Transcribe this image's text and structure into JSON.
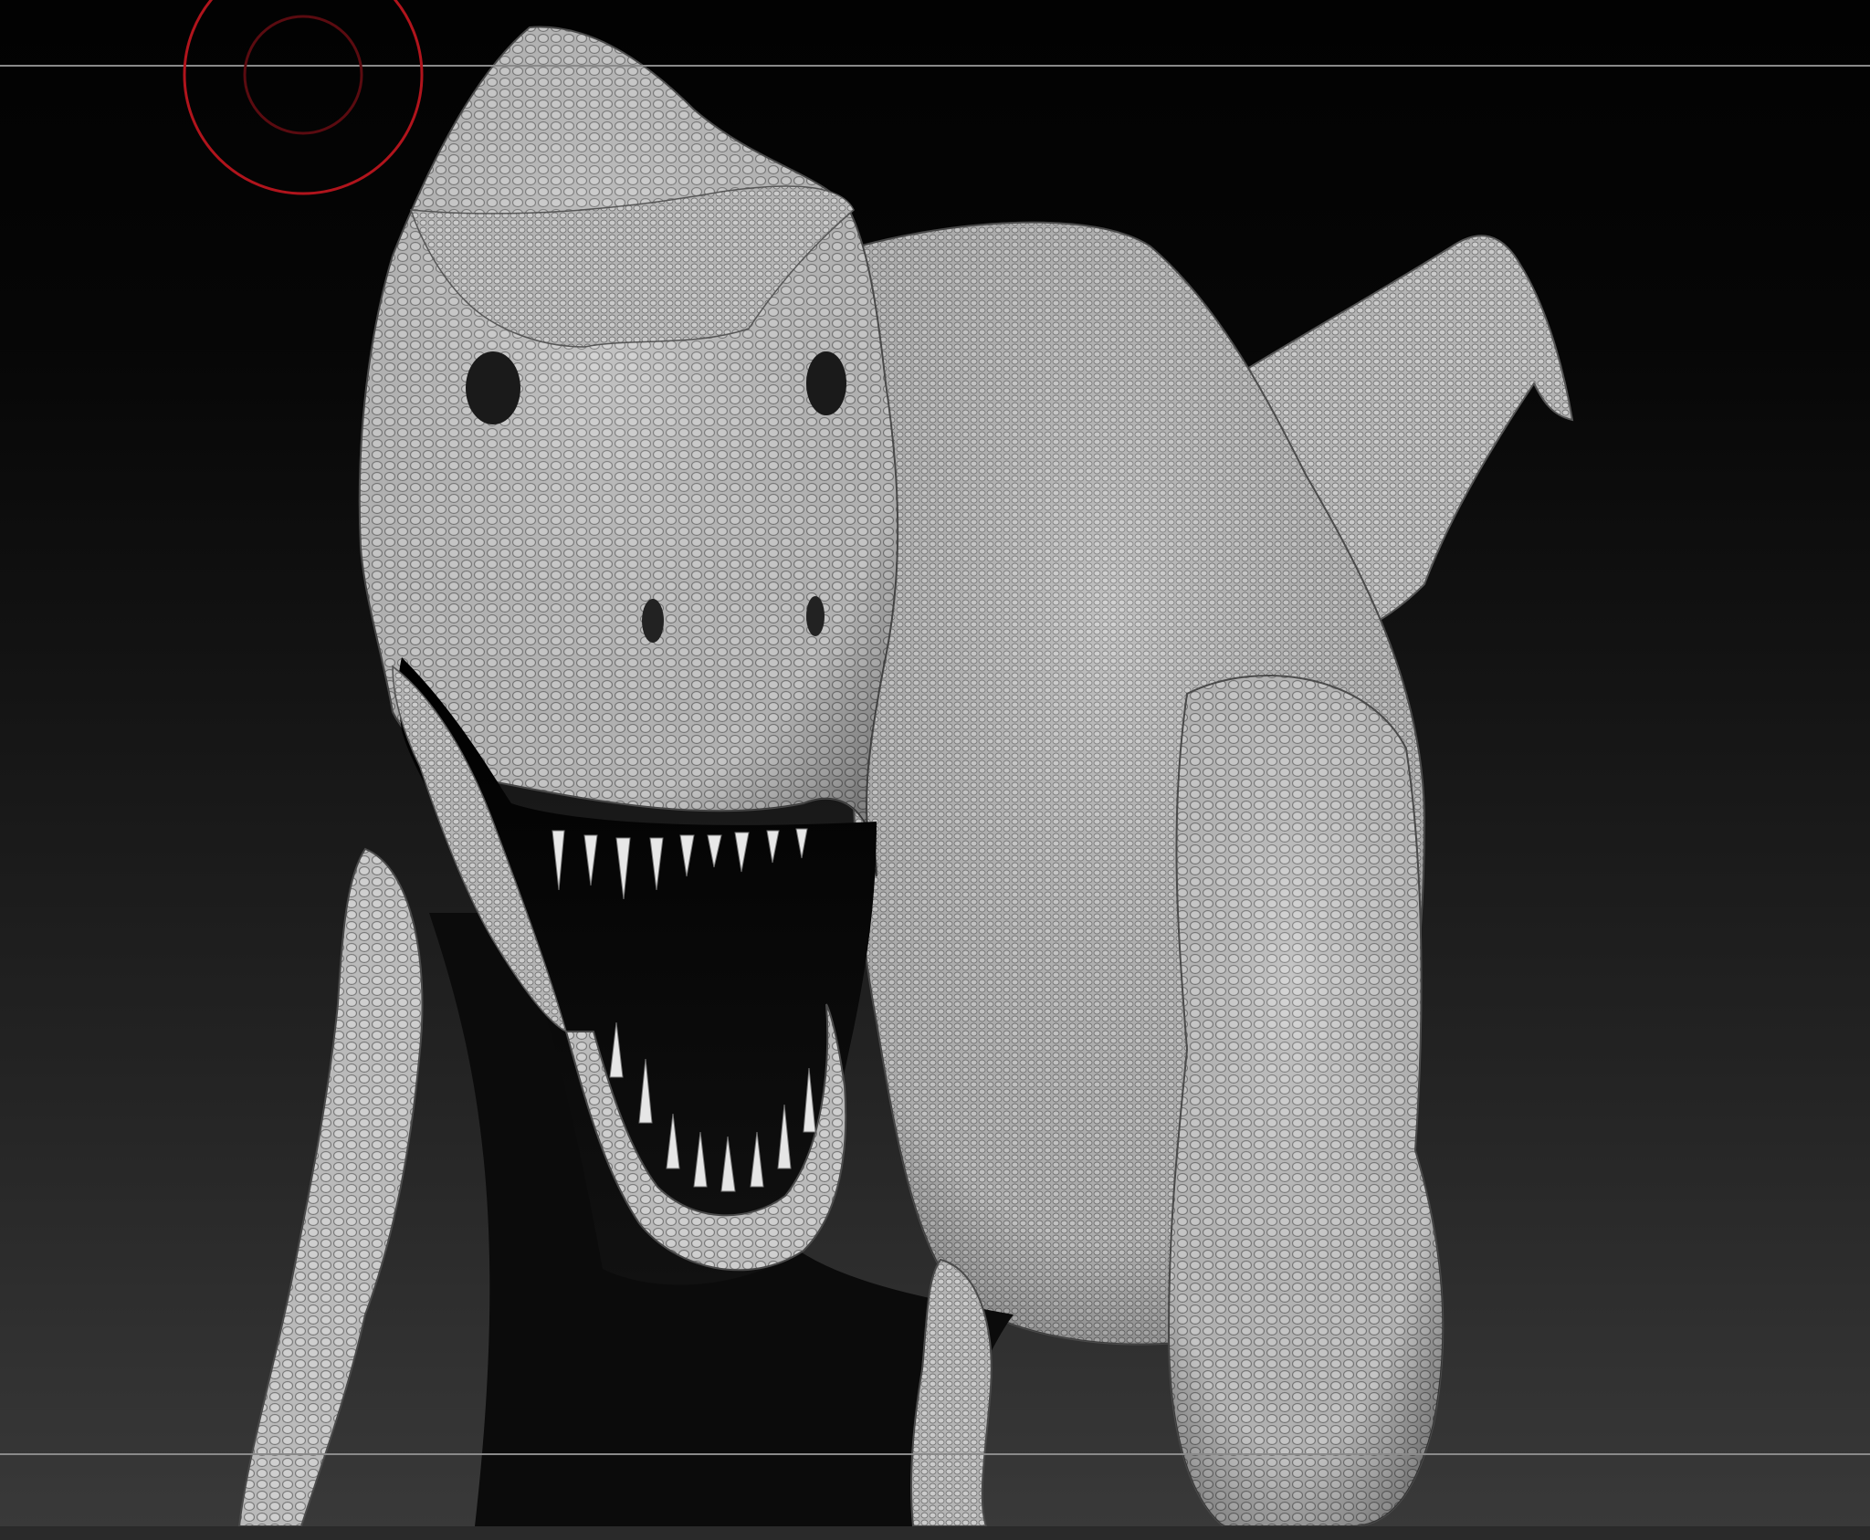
{
  "viewport": {
    "background_top": "#020202",
    "background_bottom": "#393939",
    "guide_line_color": "#8a8a8a"
  },
  "model": {
    "subject": "trex-sculpt",
    "material_color": "#bdbdbd",
    "shadow_color": "#0b0b0b"
  },
  "brush": {
    "outer_color": "#b0141c",
    "inner_color": "#5a0b10"
  }
}
